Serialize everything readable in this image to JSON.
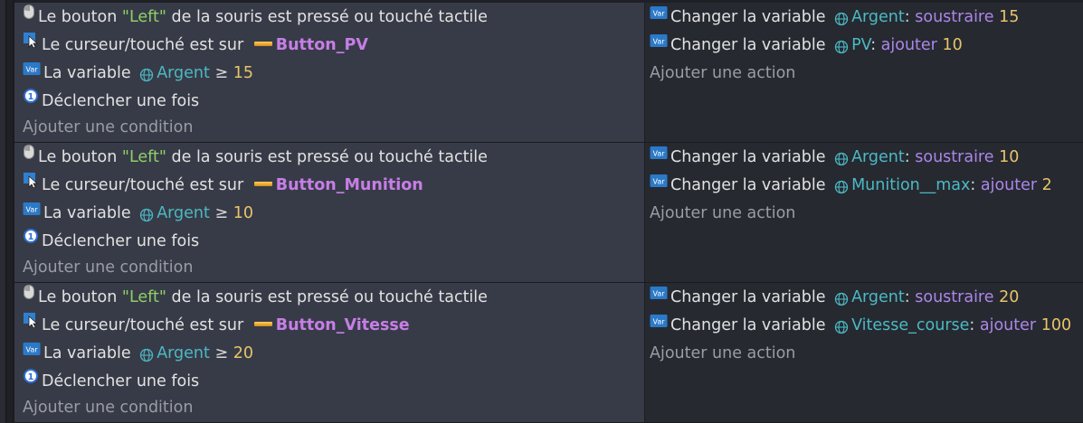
{
  "colors": {
    "condition_bg": "#373b47",
    "action_bg": "#262930",
    "string": "#8fcf6a",
    "number": "#e8c46a",
    "variable": "#4cb9c4",
    "operation": "#ad86e9",
    "object": "#c77ee6",
    "placeholder": "#9a9da6"
  },
  "events": [
    {
      "conditions": {
        "mouse": {
          "prefix": "Le bouton ",
          "button": "\"Left\"",
          "suffix": " de la souris est pressé ou touché tactile"
        },
        "cursor": {
          "text": "Le curseur/touché est sur ",
          "object": "Button_PV"
        },
        "variable": {
          "text": "La variable ",
          "name": "Argent",
          "comparator": "≥",
          "value": "15"
        },
        "once": {
          "text": "Déclencher une fois"
        },
        "add_label": "Ajouter une condition"
      },
      "actions": [
        {
          "text": "Changer la variable ",
          "name": "Argent",
          "sep": ":",
          "operation": "soustraire",
          "value": "15"
        },
        {
          "text": "Changer la variable ",
          "name": "PV",
          "sep": ":",
          "operation": "ajouter",
          "value": "10"
        }
      ],
      "add_action_label": "Ajouter une action"
    },
    {
      "conditions": {
        "mouse": {
          "prefix": "Le bouton ",
          "button": "\"Left\"",
          "suffix": " de la souris est pressé ou touché tactile"
        },
        "cursor": {
          "text": "Le curseur/touché est sur ",
          "object": "Button_Munition"
        },
        "variable": {
          "text": "La variable ",
          "name": "Argent",
          "comparator": "≥",
          "value": "10"
        },
        "once": {
          "text": "Déclencher une fois"
        },
        "add_label": "Ajouter une condition"
      },
      "actions": [
        {
          "text": "Changer la variable ",
          "name": "Argent",
          "sep": ":",
          "operation": "soustraire",
          "value": "10"
        },
        {
          "text": "Changer la variable ",
          "name": "Munition__max",
          "sep": ":",
          "operation": "ajouter",
          "value": "2"
        }
      ],
      "add_action_label": "Ajouter une action"
    },
    {
      "conditions": {
        "mouse": {
          "prefix": "Le bouton ",
          "button": "\"Left\"",
          "suffix": " de la souris est pressé ou touché tactile"
        },
        "cursor": {
          "text": "Le curseur/touché est sur ",
          "object": "Button_Vitesse"
        },
        "variable": {
          "text": "La variable ",
          "name": "Argent",
          "comparator": "≥",
          "value": "20"
        },
        "once": {
          "text": "Déclencher une fois"
        },
        "add_label": "Ajouter une condition"
      },
      "actions": [
        {
          "text": "Changer la variable ",
          "name": "Argent",
          "sep": ":",
          "operation": "soustraire",
          "value": "20"
        },
        {
          "text": "Changer la variable ",
          "name": "Vitesse_course",
          "sep": ":",
          "operation": "ajouter",
          "value": "100"
        }
      ],
      "add_action_label": "Ajouter une action"
    }
  ]
}
